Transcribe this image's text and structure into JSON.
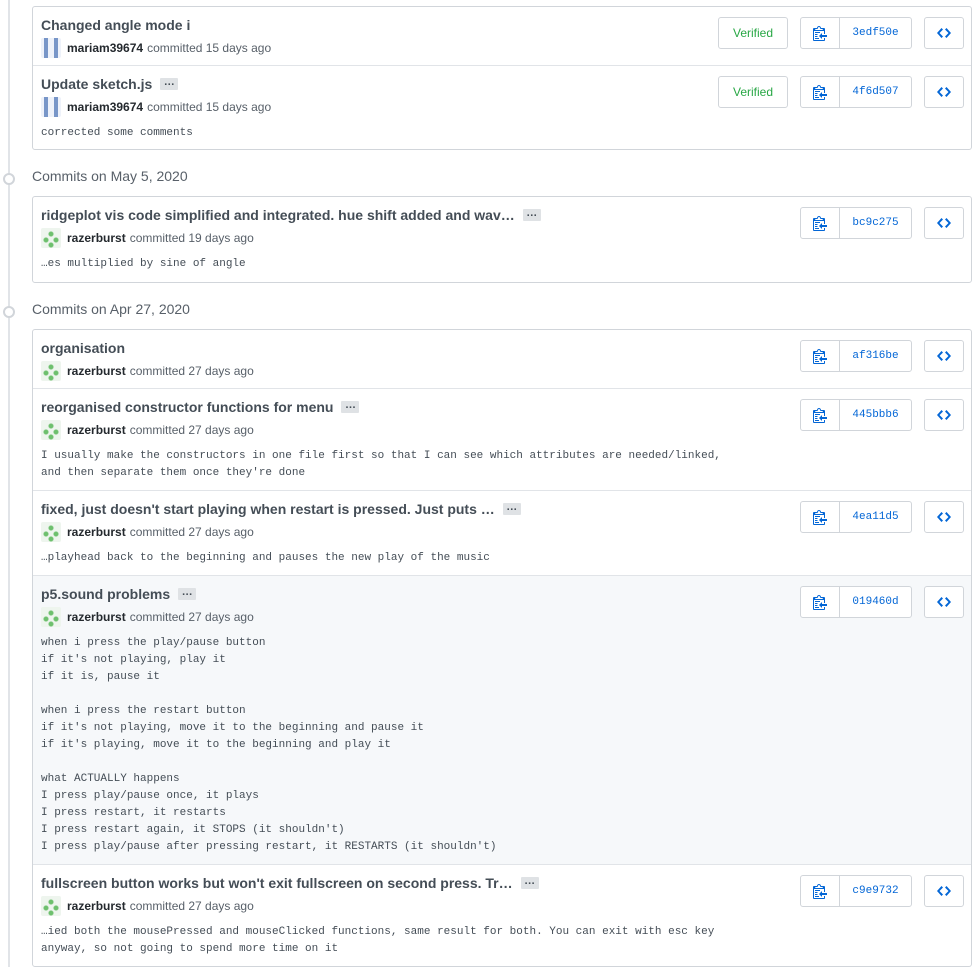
{
  "groups": [
    {
      "header": "",
      "commits": [
        {
          "title": "Changed angle mode i",
          "has_ellipsis": false,
          "author": "mariam39674",
          "time": "committed 15 days ago",
          "avatar": "mariam",
          "verified": "Verified",
          "sha": "3edf50e",
          "desc": ""
        },
        {
          "title": "Update sketch.js",
          "has_ellipsis": true,
          "author": "mariam39674",
          "time": "committed 15 days ago",
          "avatar": "mariam",
          "verified": "Verified",
          "sha": "4f6d507",
          "desc": "corrected some comments"
        }
      ]
    },
    {
      "header": "Commits on May 5, 2020",
      "commits": [
        {
          "title": "ridgeplot vis code simplified and integrated. hue shift added and wav…",
          "has_ellipsis": true,
          "author": "razerburst",
          "time": "committed 19 days ago",
          "avatar": "razer",
          "verified": "",
          "sha": "bc9c275",
          "desc": "…es multiplied by sine of angle"
        }
      ]
    },
    {
      "header": "Commits on Apr 27, 2020",
      "commits": [
        {
          "title": "organisation",
          "has_ellipsis": false,
          "author": "razerburst",
          "time": "committed 27 days ago",
          "avatar": "razer",
          "verified": "",
          "sha": "af316be",
          "desc": ""
        },
        {
          "title": "reorganised constructor functions for menu",
          "has_ellipsis": true,
          "author": "razerburst",
          "time": "committed 27 days ago",
          "avatar": "razer",
          "verified": "",
          "sha": "445bbb6",
          "desc": "I usually make the constructors in one file first so that I can see which attributes are needed/linked,\nand then separate them once they're done"
        },
        {
          "title": "fixed, just doesn't start playing when restart is pressed. Just puts …",
          "has_ellipsis": true,
          "author": "razerburst",
          "time": "committed 27 days ago",
          "avatar": "razer",
          "verified": "",
          "sha": "4ea11d5",
          "desc": "…playhead back to the beginning and pauses the new play of the music"
        },
        {
          "title": "p5.sound problems",
          "has_ellipsis": true,
          "author": "razerburst",
          "time": "committed 27 days ago",
          "avatar": "razer",
          "verified": "",
          "sha": "019460d",
          "highlighted": true,
          "desc": "when i press the play/pause button\nif it's not playing, play it\nif it is, pause it\n\nwhen i press the restart button\nif it's not playing, move it to the beginning and pause it\nif it's playing, move it to the beginning and play it\n\nwhat ACTUALLY happens\nI press play/pause once, it plays\nI press restart, it restarts\nI press restart again, it STOPS (it shouldn't)\nI press play/pause after pressing restart, it RESTARTS (it shouldn't)"
        },
        {
          "title": "fullscreen button works but won't exit fullscreen on second press. Tr…",
          "has_ellipsis": true,
          "author": "razerburst",
          "time": "committed 27 days ago",
          "avatar": "razer",
          "verified": "",
          "sha": "c9e9732",
          "desc": "…ied both the mousePressed and mouseClicked functions, same result for both. You can exit with esc key\nanyway, so not going to spend more time on it"
        }
      ]
    }
  ],
  "icons": {
    "copy": "clipboard-icon",
    "browse": "code-icon",
    "timeline": "commit-node-icon"
  },
  "colors": {
    "verified": "#28a745",
    "sha": "#0366d6",
    "highlight": "#f6f8fa"
  }
}
